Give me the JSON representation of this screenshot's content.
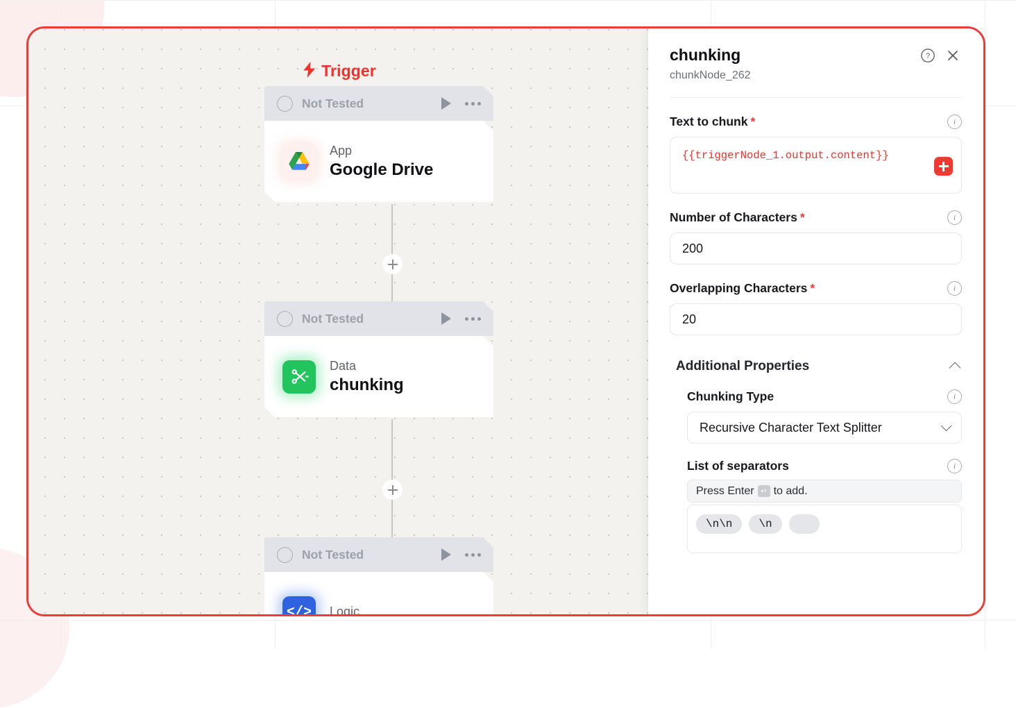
{
  "canvas": {
    "trigger_label": "Trigger",
    "trigger_icon": "lightning-bolt-icon",
    "nodes": [
      {
        "status": "Not Tested",
        "kind": "App",
        "title": "Google Drive",
        "icon": "google-drive-icon"
      },
      {
        "status": "Not Tested",
        "kind": "Data",
        "title": "chunking",
        "icon": "scissors-icon"
      },
      {
        "status": "Not Tested",
        "kind": "Logic",
        "title": "",
        "icon": "code-brackets-icon"
      }
    ],
    "add_node_label": "+"
  },
  "panel": {
    "title": "chunking",
    "subtitle": "chunkNode_262",
    "help_icon": "question-mark-circle-icon",
    "close_icon": "close-icon",
    "fields": {
      "text_to_chunk": {
        "label": "Text to chunk",
        "required": "*",
        "value": "{{triggerNode_1.output.content}}",
        "add_button": "+"
      },
      "number_of_characters": {
        "label": "Number of Characters",
        "required": "*",
        "value": "200"
      },
      "overlapping_characters": {
        "label": "Overlapping Characters",
        "required": "*",
        "value": "20"
      }
    },
    "additional_properties": {
      "title": "Additional Properties",
      "chunking_type": {
        "label": "Chunking Type",
        "value": "Recursive Character Text Splitter"
      },
      "list_of_separators": {
        "label": "List of separators",
        "placeholder_prefix": "Press Enter",
        "placeholder_key": "↵",
        "placeholder_suffix": "to add.",
        "chips": [
          "\\n\\n",
          "\\n",
          ""
        ]
      }
    }
  },
  "colors": {
    "accent_red": "#ef3b36",
    "node_header": "#e1e3e8",
    "canvas_bg": "#f3f2ef",
    "chunk_green": "#21c45d",
    "logic_blue": "#2f62e0"
  }
}
